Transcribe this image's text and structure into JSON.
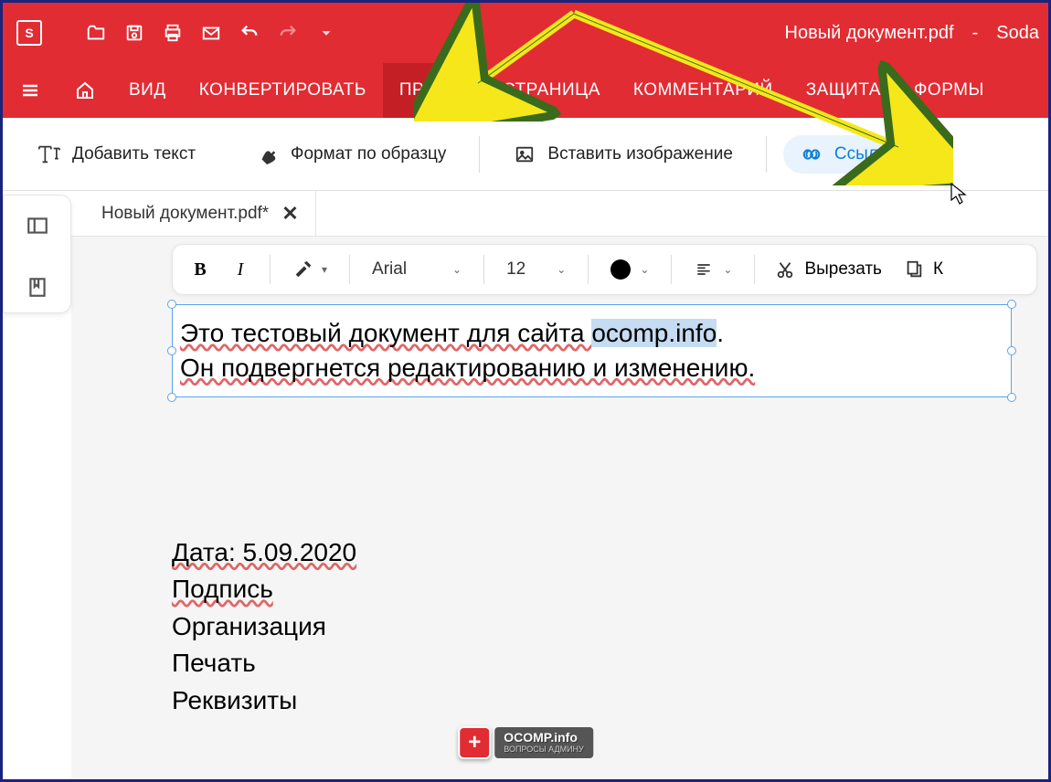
{
  "app": {
    "logo_letter": "S",
    "title": "Новый документ.pdf",
    "sep": "-",
    "brand": "Soda"
  },
  "menu": {
    "items": [
      "ВИД",
      "КОНВЕРТИРОВАТЬ",
      "ПРАВКА",
      "СТРАНИЦА",
      "КОММЕНТАРИЙ",
      "ЗАЩИТА",
      "ФОРМЫ"
    ],
    "active_index": 2
  },
  "tools": {
    "add_text": "Добавить текст",
    "format_painter": "Формат по образцу",
    "insert_image": "Вставить изображение",
    "link": "Ссылка"
  },
  "tab": {
    "label": "Новый документ.pdf*"
  },
  "format": {
    "font": "Arial",
    "size": "12",
    "cut": "Вырезать",
    "copy_prefix": "К"
  },
  "document": {
    "line1_a": "Это тестовый документ для сайта ",
    "line1_hl": "ocomp.info",
    "line1_b": ".",
    "line2": "Он подвергнется редактированию и изменению.",
    "block2": {
      "date": "Дата: 5.09.2020",
      "sign": "Подпись",
      "org": "Организация",
      "stamp": "Печать",
      "req": "Реквизиты"
    }
  },
  "watermark": {
    "main": "OCOMP.info",
    "sub": "ВОПРОСЫ АДМИНУ"
  }
}
